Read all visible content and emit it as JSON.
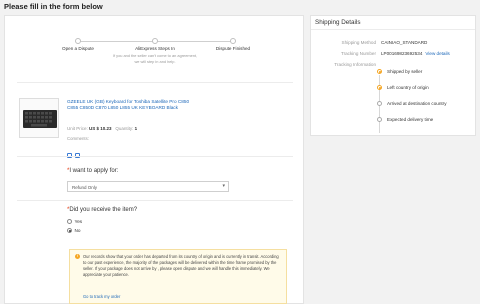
{
  "page": {
    "title": "Please fill in the form below"
  },
  "steps": [
    {
      "label": "Open a Dispute",
      "sub": ""
    },
    {
      "label": "AliExpress Steps In",
      "sub": "If you and the seller can't come to an agreement, we will step in and help."
    },
    {
      "label": "Dispute Finished",
      "sub": ""
    }
  ],
  "product": {
    "title": "GZEELE UK (GB) Keyboard for Toshiba Satellite Pro C850 C855 C850D C870 L850 L855 UK KEYBOARD Black",
    "unit_price_label": "Unit Price:",
    "unit_price_value": "US $ 10.23",
    "quantity_label": "Quantity:",
    "quantity_value": "1",
    "comments_label": "Comments:",
    "thumb_brand": "GZEELE"
  },
  "apply": {
    "question": "I want to apply for:",
    "required_mark": "*",
    "selected": "Refund Only"
  },
  "received": {
    "question": "Did you receive the item?",
    "required_mark": "*",
    "options": [
      {
        "label": "Yes",
        "checked": false
      },
      {
        "label": "No",
        "checked": true
      }
    ]
  },
  "notice": {
    "text": "Our records show that your order has departed from its country of origin and is currently in transit. According to our past experience, the majority of the packages will be delivered within the time frame promised by the seller. If your package does not arrive by , please open dispute and we will handle this immediately. We appreciate your patience.",
    "link": "Go to track my order",
    "accent_color": "#f5a623"
  },
  "shipping": {
    "header": "Shipping Details",
    "method_label": "Shipping Method",
    "method_value": "CAINIAO_STANDARD",
    "tracking_label": "Tracking Number",
    "tracking_value": "LP00169823692534",
    "view_details": "View details",
    "info_label": "Tracking Information",
    "events": [
      {
        "label": "Shipped by seller",
        "active": true
      },
      {
        "label": "Left country of origin",
        "active": true
      },
      {
        "label": "Arrived at destination country",
        "active": false
      },
      {
        "label": "Expected delivery time",
        "active": false
      }
    ]
  },
  "colors": {
    "link": "#1a66b8",
    "required": "#e62e04",
    "background": "#f2f2f2"
  }
}
